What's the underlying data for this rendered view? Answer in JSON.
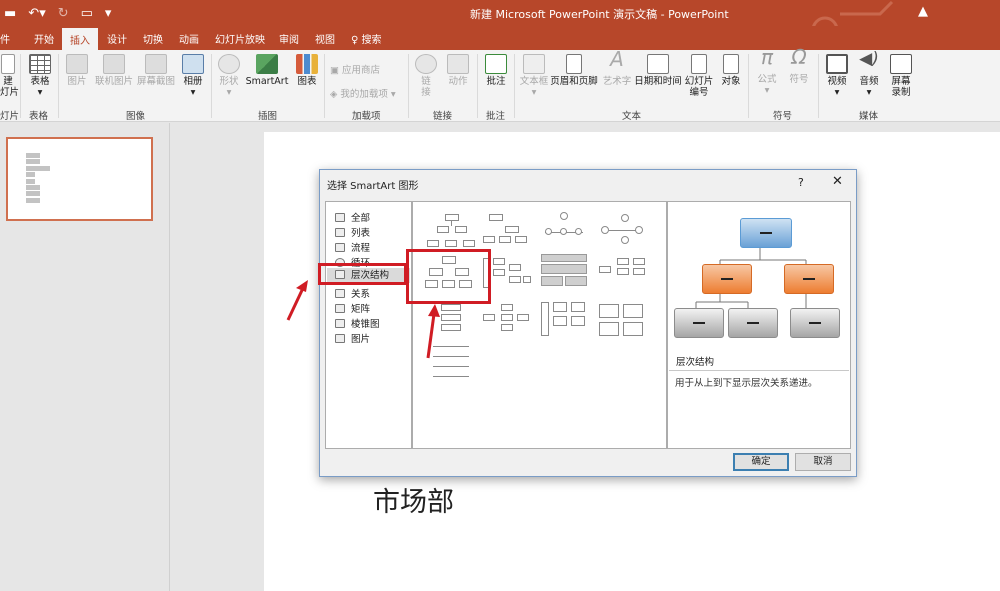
{
  "window": {
    "title": "新建 Microsoft PowerPoint 演示文稿 - PowerPoint",
    "qat_file_fragment": "件"
  },
  "tabs": [
    {
      "label": "开始"
    },
    {
      "label": "插入"
    },
    {
      "label": "设计"
    },
    {
      "label": "切换"
    },
    {
      "label": "动画"
    },
    {
      "label": "幻灯片放映"
    },
    {
      "label": "审阅"
    },
    {
      "label": "视图"
    },
    {
      "label": "搜索"
    }
  ],
  "active_tab": "插入",
  "ribbon": {
    "new_slide": {
      "line1": "建",
      "line2": "灯片"
    },
    "slides_group_fragment": "灯片",
    "table": "表格",
    "table_group": "表格",
    "picture": "图片",
    "online_picture": "联机图片",
    "screenshot": "屏幕截图",
    "album": "相册",
    "images_group": "图像",
    "shapes": "形状",
    "smartart": "SmartArt",
    "chart": "图表",
    "illustrations_group": "插图",
    "store": "应用商店",
    "my_addins": "我的加载项",
    "addins_group": "加载项",
    "link_line1": "链",
    "link_line2": "接",
    "action": "动作",
    "links_group": "链接",
    "comment": "批注",
    "comments_group": "批注",
    "textbox": "文本框",
    "header_footer": "页眉和页脚",
    "wordart": "艺术字",
    "datetime": "日期和时间",
    "slide_number_line1": "幻灯片",
    "slide_number_line2": "编号",
    "object": "对象",
    "text_group": "文本",
    "equation": "公式",
    "symbol": "符号",
    "symbols_group": "符号",
    "video": "视频",
    "audio": "音频",
    "screen_recording_line1": "屏幕",
    "screen_recording_line2": "录制",
    "media_group": "媒体"
  },
  "thumbnail_lines": [
    "总经理",
    "生产部",
    "人力资源部",
    "项目",
    "研发",
    "销售部",
    "产品部",
    "市场部"
  ],
  "slide_visible_text": "市场部",
  "dialog": {
    "title": "选择 SmartArt 图形",
    "help": "?",
    "close": "✕",
    "categories": [
      {
        "label": "全部"
      },
      {
        "label": "列表"
      },
      {
        "label": "流程"
      },
      {
        "label": "循环"
      },
      {
        "label": "层次结构"
      },
      {
        "label": "关系"
      },
      {
        "label": "矩阵"
      },
      {
        "label": "棱锥图"
      },
      {
        "label": "图片"
      }
    ],
    "selected_category": "层次结构",
    "preview_name": "层次结构",
    "preview_description": "用于从上到下显示层次关系递进。",
    "ok": "确定",
    "cancel": "取消"
  },
  "colors": {
    "accent": "#b7472a",
    "ribbon_bg": "#f3f3f3",
    "highlight_red": "#d01c24",
    "preview_blue": "#5b9bd5",
    "preview_orange": "#ed7d31",
    "preview_gray": "#a5a5a5"
  }
}
